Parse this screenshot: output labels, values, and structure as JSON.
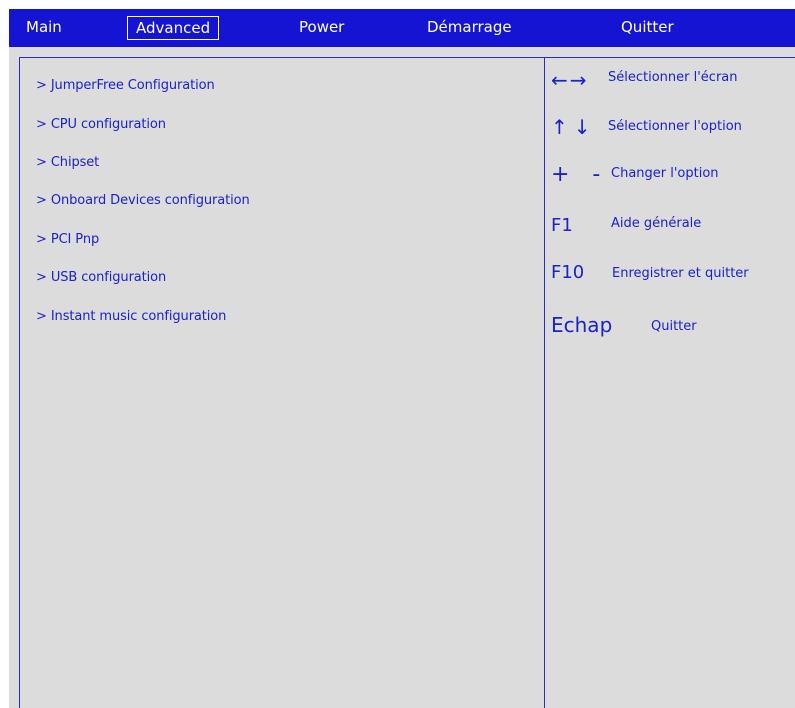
{
  "menu": {
    "tabs": [
      {
        "label": "Main"
      },
      {
        "label": "Advanced"
      },
      {
        "label": "Power"
      },
      {
        "label": "Démarrage"
      },
      {
        "label": "Quitter"
      }
    ],
    "selected": "Advanced"
  },
  "items": [
    {
      "label": "> JumperFree Configuration"
    },
    {
      "label": "> CPU configuration"
    },
    {
      "label": "> Chipset"
    },
    {
      "label": "> Onboard Devices configuration"
    },
    {
      "label": "> PCI Pnp"
    },
    {
      "label": "> USB configuration"
    },
    {
      "label": "> Instant music configuration"
    }
  ],
  "help": [
    {
      "key": "←→",
      "desc": "Sélectionner l'écran",
      "icon": "left-right-arrows-icon"
    },
    {
      "key": "↑↓",
      "desc": "Sélectionner l'option",
      "icon": "up-down-arrows-icon"
    },
    {
      "key": "+ -",
      "desc": "Changer l'option"
    },
    {
      "key": "F1",
      "desc": "Aide générale"
    },
    {
      "key": "F10",
      "desc": "Enregistrer et quitter"
    },
    {
      "key": "Echap",
      "desc": "Quitter"
    }
  ],
  "colors": {
    "menubar": "#1414d2",
    "background": "#dcdcdc",
    "text": "#1a22c8"
  }
}
